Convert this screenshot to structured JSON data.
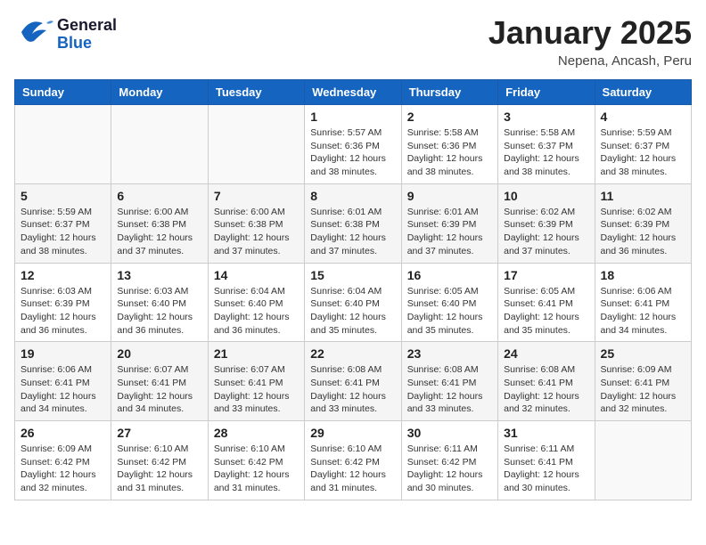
{
  "header": {
    "logo_general": "General",
    "logo_blue": "Blue",
    "month_title": "January 2025",
    "subtitle": "Nepena, Ancash, Peru"
  },
  "weekdays": [
    "Sunday",
    "Monday",
    "Tuesday",
    "Wednesday",
    "Thursday",
    "Friday",
    "Saturday"
  ],
  "weeks": [
    [
      {
        "day": "",
        "info": ""
      },
      {
        "day": "",
        "info": ""
      },
      {
        "day": "",
        "info": ""
      },
      {
        "day": "1",
        "info": "Sunrise: 5:57 AM\nSunset: 6:36 PM\nDaylight: 12 hours\nand 38 minutes."
      },
      {
        "day": "2",
        "info": "Sunrise: 5:58 AM\nSunset: 6:36 PM\nDaylight: 12 hours\nand 38 minutes."
      },
      {
        "day": "3",
        "info": "Sunrise: 5:58 AM\nSunset: 6:37 PM\nDaylight: 12 hours\nand 38 minutes."
      },
      {
        "day": "4",
        "info": "Sunrise: 5:59 AM\nSunset: 6:37 PM\nDaylight: 12 hours\nand 38 minutes."
      }
    ],
    [
      {
        "day": "5",
        "info": "Sunrise: 5:59 AM\nSunset: 6:37 PM\nDaylight: 12 hours\nand 38 minutes."
      },
      {
        "day": "6",
        "info": "Sunrise: 6:00 AM\nSunset: 6:38 PM\nDaylight: 12 hours\nand 37 minutes."
      },
      {
        "day": "7",
        "info": "Sunrise: 6:00 AM\nSunset: 6:38 PM\nDaylight: 12 hours\nand 37 minutes."
      },
      {
        "day": "8",
        "info": "Sunrise: 6:01 AM\nSunset: 6:38 PM\nDaylight: 12 hours\nand 37 minutes."
      },
      {
        "day": "9",
        "info": "Sunrise: 6:01 AM\nSunset: 6:39 PM\nDaylight: 12 hours\nand 37 minutes."
      },
      {
        "day": "10",
        "info": "Sunrise: 6:02 AM\nSunset: 6:39 PM\nDaylight: 12 hours\nand 37 minutes."
      },
      {
        "day": "11",
        "info": "Sunrise: 6:02 AM\nSunset: 6:39 PM\nDaylight: 12 hours\nand 36 minutes."
      }
    ],
    [
      {
        "day": "12",
        "info": "Sunrise: 6:03 AM\nSunset: 6:39 PM\nDaylight: 12 hours\nand 36 minutes."
      },
      {
        "day": "13",
        "info": "Sunrise: 6:03 AM\nSunset: 6:40 PM\nDaylight: 12 hours\nand 36 minutes."
      },
      {
        "day": "14",
        "info": "Sunrise: 6:04 AM\nSunset: 6:40 PM\nDaylight: 12 hours\nand 36 minutes."
      },
      {
        "day": "15",
        "info": "Sunrise: 6:04 AM\nSunset: 6:40 PM\nDaylight: 12 hours\nand 35 minutes."
      },
      {
        "day": "16",
        "info": "Sunrise: 6:05 AM\nSunset: 6:40 PM\nDaylight: 12 hours\nand 35 minutes."
      },
      {
        "day": "17",
        "info": "Sunrise: 6:05 AM\nSunset: 6:41 PM\nDaylight: 12 hours\nand 35 minutes."
      },
      {
        "day": "18",
        "info": "Sunrise: 6:06 AM\nSunset: 6:41 PM\nDaylight: 12 hours\nand 34 minutes."
      }
    ],
    [
      {
        "day": "19",
        "info": "Sunrise: 6:06 AM\nSunset: 6:41 PM\nDaylight: 12 hours\nand 34 minutes."
      },
      {
        "day": "20",
        "info": "Sunrise: 6:07 AM\nSunset: 6:41 PM\nDaylight: 12 hours\nand 34 minutes."
      },
      {
        "day": "21",
        "info": "Sunrise: 6:07 AM\nSunset: 6:41 PM\nDaylight: 12 hours\nand 33 minutes."
      },
      {
        "day": "22",
        "info": "Sunrise: 6:08 AM\nSunset: 6:41 PM\nDaylight: 12 hours\nand 33 minutes."
      },
      {
        "day": "23",
        "info": "Sunrise: 6:08 AM\nSunset: 6:41 PM\nDaylight: 12 hours\nand 33 minutes."
      },
      {
        "day": "24",
        "info": "Sunrise: 6:08 AM\nSunset: 6:41 PM\nDaylight: 12 hours\nand 32 minutes."
      },
      {
        "day": "25",
        "info": "Sunrise: 6:09 AM\nSunset: 6:41 PM\nDaylight: 12 hours\nand 32 minutes."
      }
    ],
    [
      {
        "day": "26",
        "info": "Sunrise: 6:09 AM\nSunset: 6:42 PM\nDaylight: 12 hours\nand 32 minutes."
      },
      {
        "day": "27",
        "info": "Sunrise: 6:10 AM\nSunset: 6:42 PM\nDaylight: 12 hours\nand 31 minutes."
      },
      {
        "day": "28",
        "info": "Sunrise: 6:10 AM\nSunset: 6:42 PM\nDaylight: 12 hours\nand 31 minutes."
      },
      {
        "day": "29",
        "info": "Sunrise: 6:10 AM\nSunset: 6:42 PM\nDaylight: 12 hours\nand 31 minutes."
      },
      {
        "day": "30",
        "info": "Sunrise: 6:11 AM\nSunset: 6:42 PM\nDaylight: 12 hours\nand 30 minutes."
      },
      {
        "day": "31",
        "info": "Sunrise: 6:11 AM\nSunset: 6:41 PM\nDaylight: 12 hours\nand 30 minutes."
      },
      {
        "day": "",
        "info": ""
      }
    ]
  ]
}
